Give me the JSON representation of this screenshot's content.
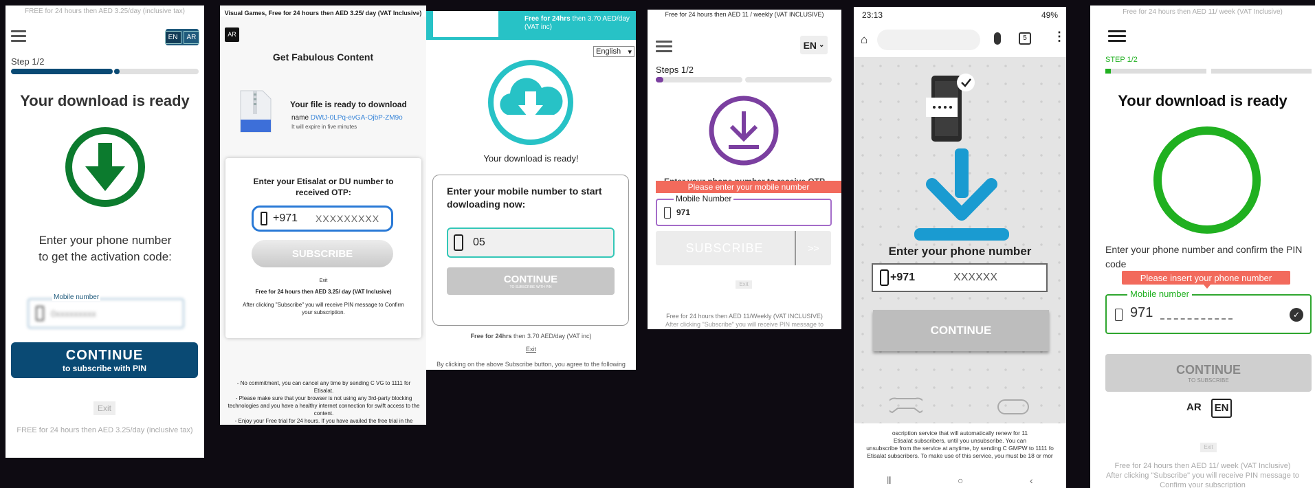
{
  "colors": {
    "panel1_brand": "#0a4a74",
    "panel1_icon": "#0c7b2e",
    "panel2_input": "#2979d6",
    "panel3_accent": "#27c2c6",
    "panel4_accent": "#7b3fa0",
    "panel4_error": "#f26a5c",
    "panel5_arrow": "#1a9bd1",
    "panel6_ring": "#20b020",
    "panel6_error": "#f26a5c"
  },
  "panel1": {
    "banner": "FREE for 24 hours then AED 3.25/day (inclusive tax)",
    "lang": [
      "EN",
      "AR"
    ],
    "step": "Step 1/2",
    "title": "Your download is ready",
    "prompt": "Enter your phone number to get the activation code:",
    "field_label": "Mobile number",
    "field_value": "0xxxxxxxxx",
    "cta": "CONTINUE",
    "cta_sub": "to subscribe with PIN",
    "exit": "Exit",
    "footer": "FREE for 24 hours then AED 3.25/day (inclusive tax)"
  },
  "panel2": {
    "banner": "Visual Games, Free for 24 hours then AED 3.25/ day (VAT Inclusive)",
    "lang": "AR",
    "heading": "Get Fabulous Content",
    "file_ready": "Your file is ready to download",
    "file_name_label": "name",
    "file_name": "DWtJ-0LPq-evGA-OjbP-ZM9o",
    "expire": "It will expire in five minutes",
    "otp_prompt": "Enter your Etisalat or DU number to received OTP:",
    "prefix": "+971",
    "placeholder": "XXXXXXXXX",
    "subscribe": "SUBSCRIBE",
    "exit": "Exit",
    "price": "Free for 24 hours then AED 3.25/ day (VAT Inclusive)",
    "pin_note": "After clicking \"Subscribe\" you will receive PIN message to Confirm your subscription.",
    "terms": [
      "- No commitment, you can cancel any time by sending C VG to 1111 for Etisalat.",
      "- Please make sure that your browser is not using any 3rd-party blocking technologies and you have a healthy internet connection for swift access to the content.",
      "- Enjoy your Free trial for 24 hours. If you have availed the free trial in the"
    ]
  },
  "panel3": {
    "banner_bold": "Free for 24hrs",
    "banner_rest": " then 3.70 AED/day (VAT inc)",
    "lang": "English",
    "ready": "Your download is ready!",
    "prompt": "Enter your mobile number to start dowloading now:",
    "value": "05",
    "cta": "CONTINUE",
    "cta_sub": "TO SUBSCRIBE WITH PIN",
    "price_bold": "Free for 24hrs",
    "price_rest": " then 3.70 AED/day (VAT inc)",
    "exit": "Exit",
    "terms": "By clicking on the above Subscribe button, you agree to the following"
  },
  "panel4": {
    "banner": "Free for 24 hours then AED 11 / weekly (VAT INCLUSIVE)",
    "lang": "EN",
    "step": "Steps 1/2",
    "prompt": "Enter your phone number to receive OTP",
    "error": "Please enter your mobile number",
    "field_label": "Mobile Number",
    "prefix": "971",
    "subscribe": "SUBSCRIBE",
    "next": ">>",
    "exit": "Exit",
    "price": "Free for 24 hours then AED 11/Weekly (VAT INCLUSIVE)",
    "pin_note": "After clicking \"Subscribe\" you will receive PIN message to"
  },
  "panel5": {
    "time": "23:13",
    "battery": "49%",
    "tabs": "5",
    "heading": "Enter your phone number",
    "prefix": "+971",
    "placeholder": "XXXXXX",
    "cta": "CONTINUE",
    "terms": [
      "oscription service that will automatically renew for 11",
      "Etisalat subscribers, until you unsubscribe. You can",
      "unsubscribe from the service at anytime, by sending C GMPW to 1111 fo",
      "Etisalat subscribers. To make use of this service, you must be 18 or mor"
    ]
  },
  "panel6": {
    "banner": "Free for 24 hours then AED 11/ week (VAT Inclusive)",
    "step": "STEP 1/2",
    "title": "Your download is ready",
    "prompt": "Enter your phone number and confirm the PIN code",
    "error": "Please insert your phone number",
    "field_label": "Mobile number",
    "prefix": "971",
    "cta": "CONTINUE",
    "cta_sub": "TO SUBSCRIBE",
    "lang": [
      "AR",
      "EN"
    ],
    "exit": "Exit",
    "price": "Free for 24 hours then AED 11/ week (VAT Inclusive)",
    "pin_note": "After clicking \"Subscribe\" you will receive PIN message to",
    "confirm": "Confirm your subscription"
  }
}
